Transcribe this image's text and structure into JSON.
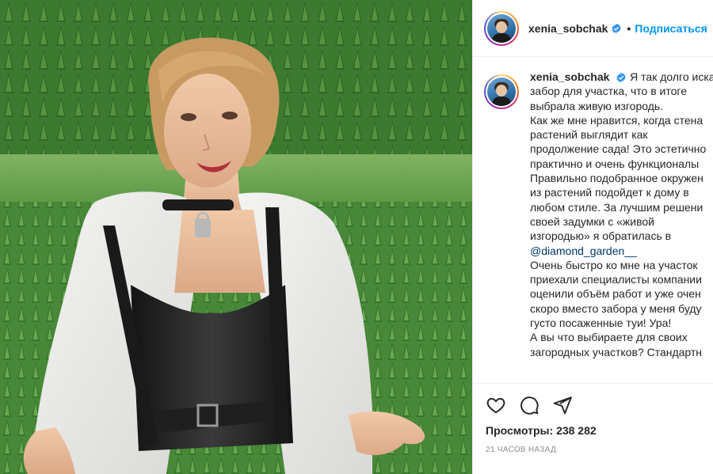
{
  "post": {
    "username": "xenia_sobchak",
    "follow_label": "Подписаться",
    "separator": "•",
    "caption_lines": [
      "Я так долго иска",
      "забор для участка, что в итоге",
      "выбрала живую изгородь.",
      "Как же мне нравится, когда стена",
      "растений выглядит как",
      "продолжение сада! Это эстетично",
      "практично и очень функционалы",
      "Правильно подобранное окружен",
      "из растений подойдет к дому в",
      "любом стиле. За лучшим решени",
      "своей задумки с «живой",
      "изгородью» я обратилась в"
    ],
    "mention": "@diamond_garden__",
    "caption_lines_after": [
      "Очень быстро ко мне на участок",
      "приехали специалисты компании",
      "оценили объём работ и уже очен",
      "скоро вместо забора у меня буду",
      "густо посаженные туи! Ура!",
      "А вы что выбираете для своих",
      "загородных участков? Стандартн"
    ],
    "views_label": "Просмотры:",
    "views_count": "238 282",
    "timestamp": "21 ЧАСОВ НАЗАД"
  },
  "icons": {
    "like": "heart-icon",
    "comment": "comment-icon",
    "share": "share-icon",
    "verified": "verified-badge-icon"
  },
  "colors": {
    "link": "#0095f6",
    "mention": "#00376b",
    "muted": "#8e8e8e",
    "verified": "#3897f0"
  }
}
